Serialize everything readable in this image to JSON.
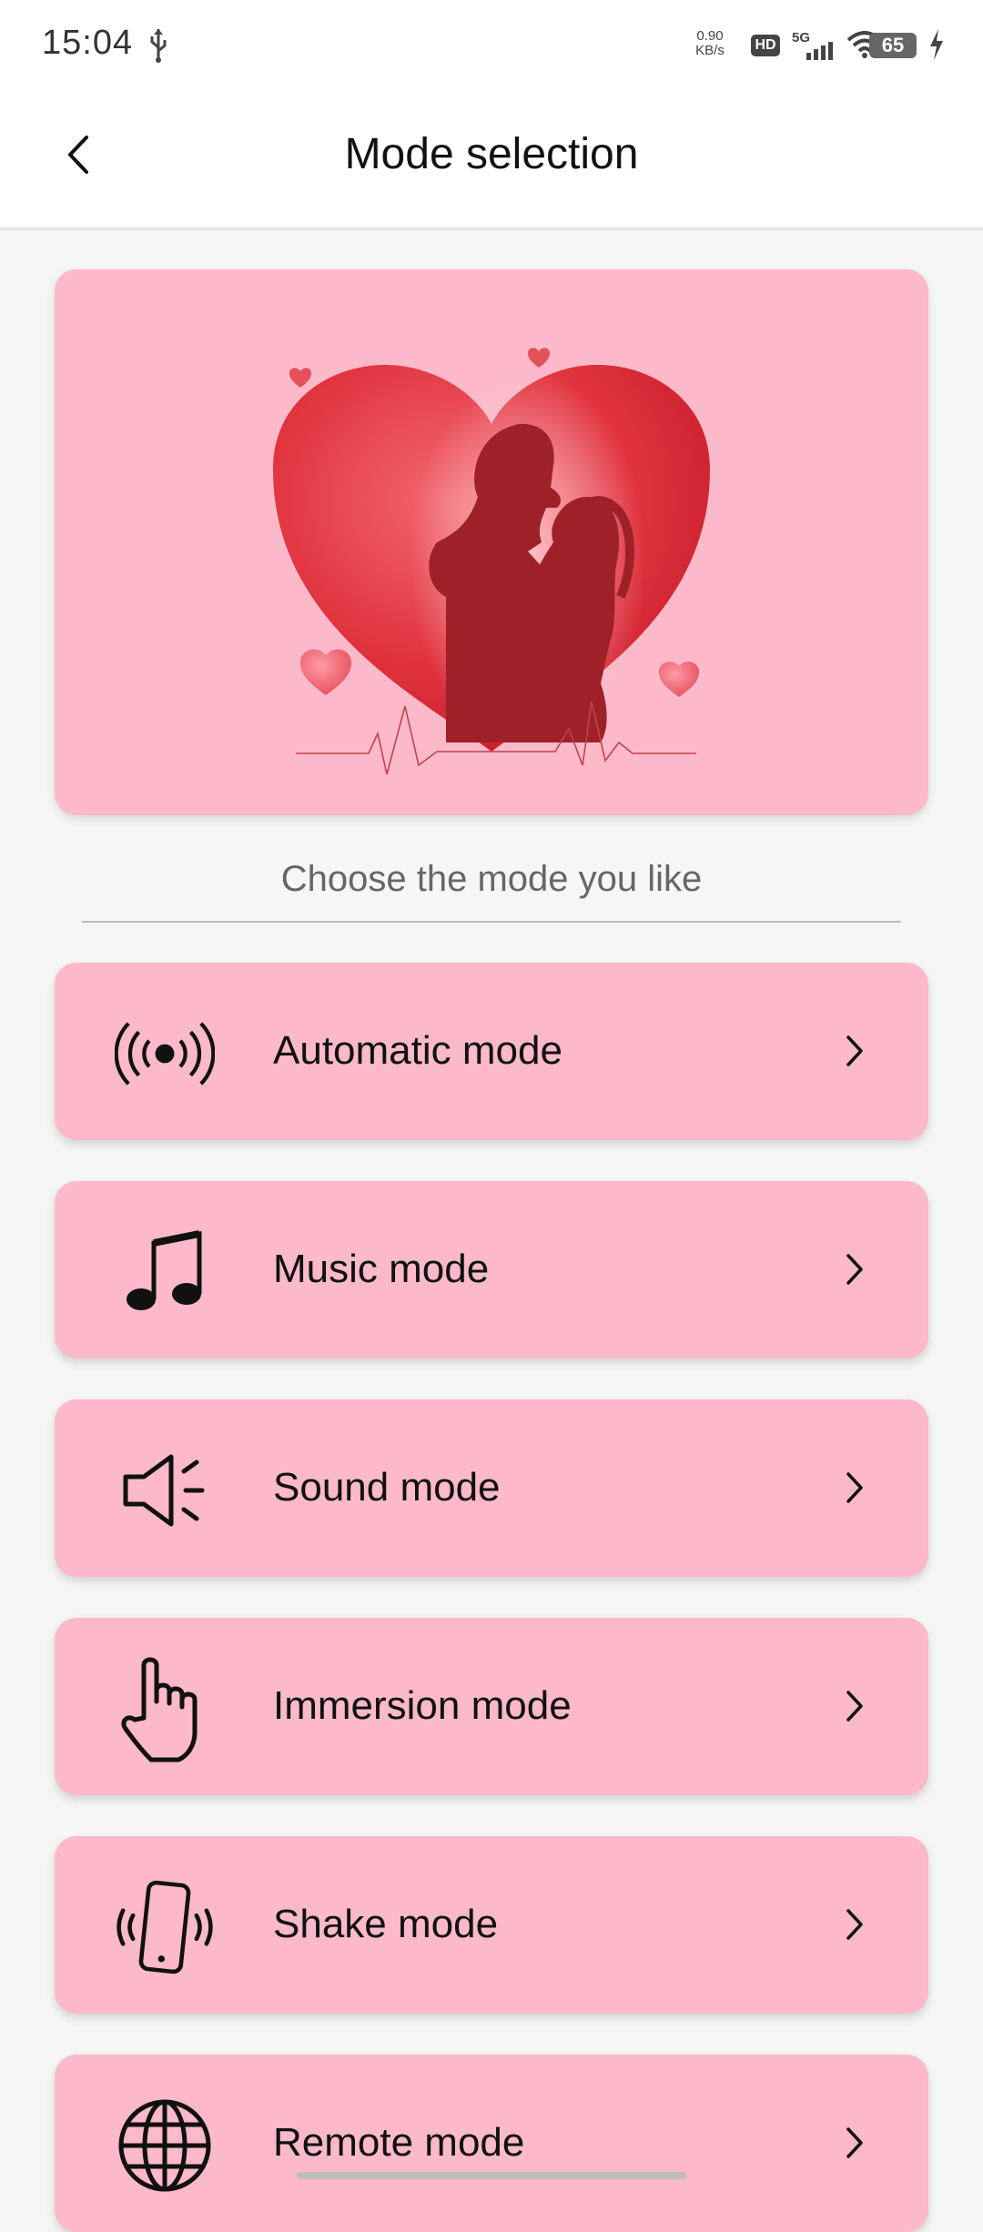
{
  "status_bar": {
    "time": "15:04",
    "net_speed_value": "0.90",
    "net_speed_unit": "KB/s",
    "hd_label": "HD",
    "network_label": "5G",
    "battery_level": "65"
  },
  "header": {
    "title": "Mode selection"
  },
  "main": {
    "subtitle": "Choose the mode you like",
    "modes": [
      {
        "label": "Automatic mode",
        "icon": "vibration-waves-icon"
      },
      {
        "label": "Music mode",
        "icon": "music-note-icon"
      },
      {
        "label": "Sound mode",
        "icon": "speaker-icon"
      },
      {
        "label": "Immersion mode",
        "icon": "hand-pointer-icon"
      },
      {
        "label": "Shake mode",
        "icon": "phone-shake-icon"
      },
      {
        "label": "Remote mode",
        "icon": "globe-icon"
      }
    ]
  },
  "colors": {
    "card_pink": "#fbb9c9",
    "heart_red": "#e0333e"
  }
}
